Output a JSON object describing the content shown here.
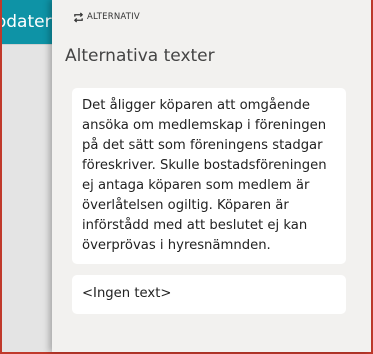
{
  "background": {
    "button_label": "Uppdatera"
  },
  "panel": {
    "tag_label": "ALTERNATIV",
    "tag_icon": "repeat-icon",
    "title": "Alternativa texter",
    "options": [
      {
        "text": "Det åligger köparen att omgående ansöka om medlemskap i föreningen på det sätt som föreningens stadgar föreskriver. Skulle bostadsföreningen ej antaga köparen som medlem är överlåtelsen ogiltig. Köparen är införstådd med att beslutet ej kan överprövas i hyresnämnden."
      },
      {
        "text": "<Ingen text>"
      }
    ]
  },
  "colors": {
    "accent": "#0e93a6",
    "frame": "#c0392b",
    "panel_bg": "#f2f1ef",
    "card_bg": "#ffffff"
  }
}
